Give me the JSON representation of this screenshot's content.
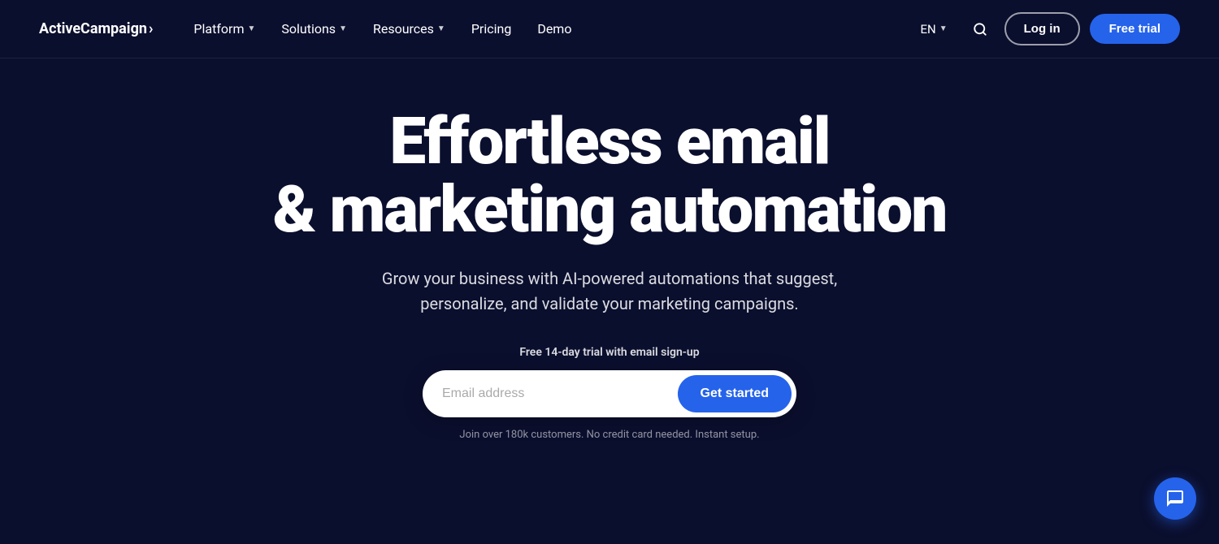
{
  "brand": {
    "name": "ActiveCampaign",
    "arrow": "›"
  },
  "nav": {
    "links": [
      {
        "label": "Platform",
        "has_dropdown": true
      },
      {
        "label": "Solutions",
        "has_dropdown": true
      },
      {
        "label": "Resources",
        "has_dropdown": true
      },
      {
        "label": "Pricing",
        "has_dropdown": false
      },
      {
        "label": "Demo",
        "has_dropdown": false
      }
    ],
    "lang": "EN",
    "login_label": "Log in",
    "free_trial_label": "Free trial"
  },
  "hero": {
    "title_line1": "Effortless email",
    "title_line2": "& marketing automation",
    "subtitle": "Grow your business with AI-powered automations that suggest, personalize, and validate your marketing campaigns.",
    "trial_label": "Free 14-day trial with email sign-up",
    "email_placeholder": "Email address",
    "cta_button": "Get started",
    "form_note": "Join over 180k customers. No credit card needed. Instant setup."
  },
  "colors": {
    "background": "#0b0f2e",
    "accent": "#2563eb",
    "text_primary": "#ffffff",
    "text_muted": "rgba(255,255,255,0.55)"
  }
}
